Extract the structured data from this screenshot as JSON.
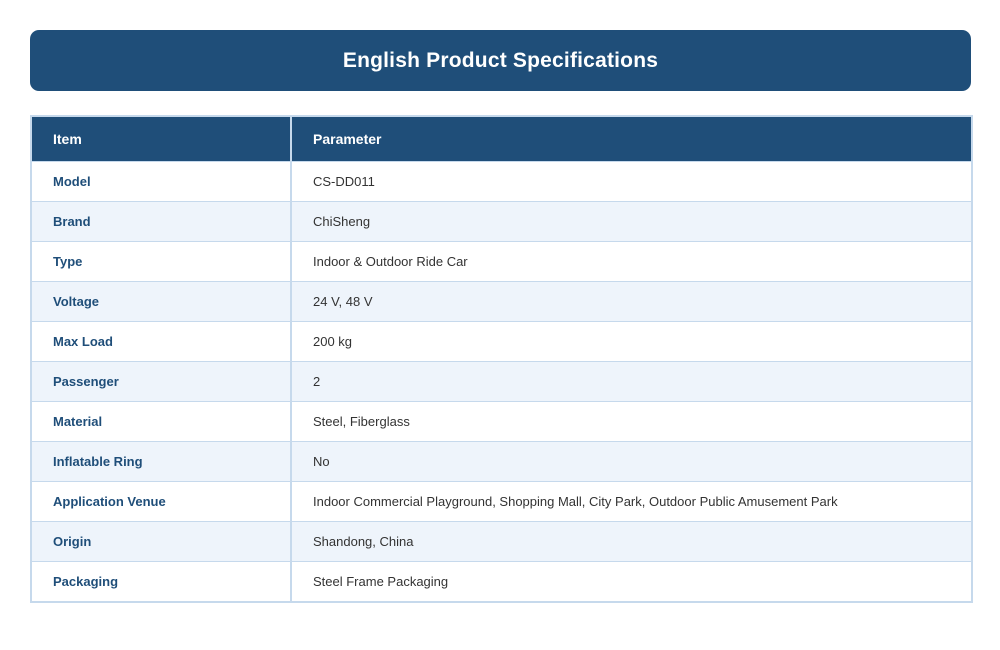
{
  "banner": {
    "title": "English Product Specifications"
  },
  "table": {
    "headers": [
      "Item",
      "Parameter"
    ],
    "rows": [
      {
        "item": "Model",
        "parameter": "CS-DD011"
      },
      {
        "item": "Brand",
        "parameter": "ChiSheng"
      },
      {
        "item": "Type",
        "parameter": "Indoor & Outdoor Ride Car"
      },
      {
        "item": "Voltage",
        "parameter": "24 V, 48 V"
      },
      {
        "item": "Max Load",
        "parameter": "200 kg"
      },
      {
        "item": "Passenger",
        "parameter": "2"
      },
      {
        "item": "Material",
        "parameter": "Steel, Fiberglass"
      },
      {
        "item": "Inflatable Ring",
        "parameter": "No"
      },
      {
        "item": "Application Venue",
        "parameter": "Indoor Commercial Playground, Shopping Mall, City Park, Outdoor Public Amusement Park"
      },
      {
        "item": "Origin",
        "parameter": "Shandong, China"
      },
      {
        "item": "Packaging",
        "parameter": "Steel Frame Packaging"
      }
    ]
  },
  "colors": {
    "header_bg": "#1f4e79",
    "row_alt_bg": "#eef4fb",
    "border": "#c6d9ec"
  }
}
